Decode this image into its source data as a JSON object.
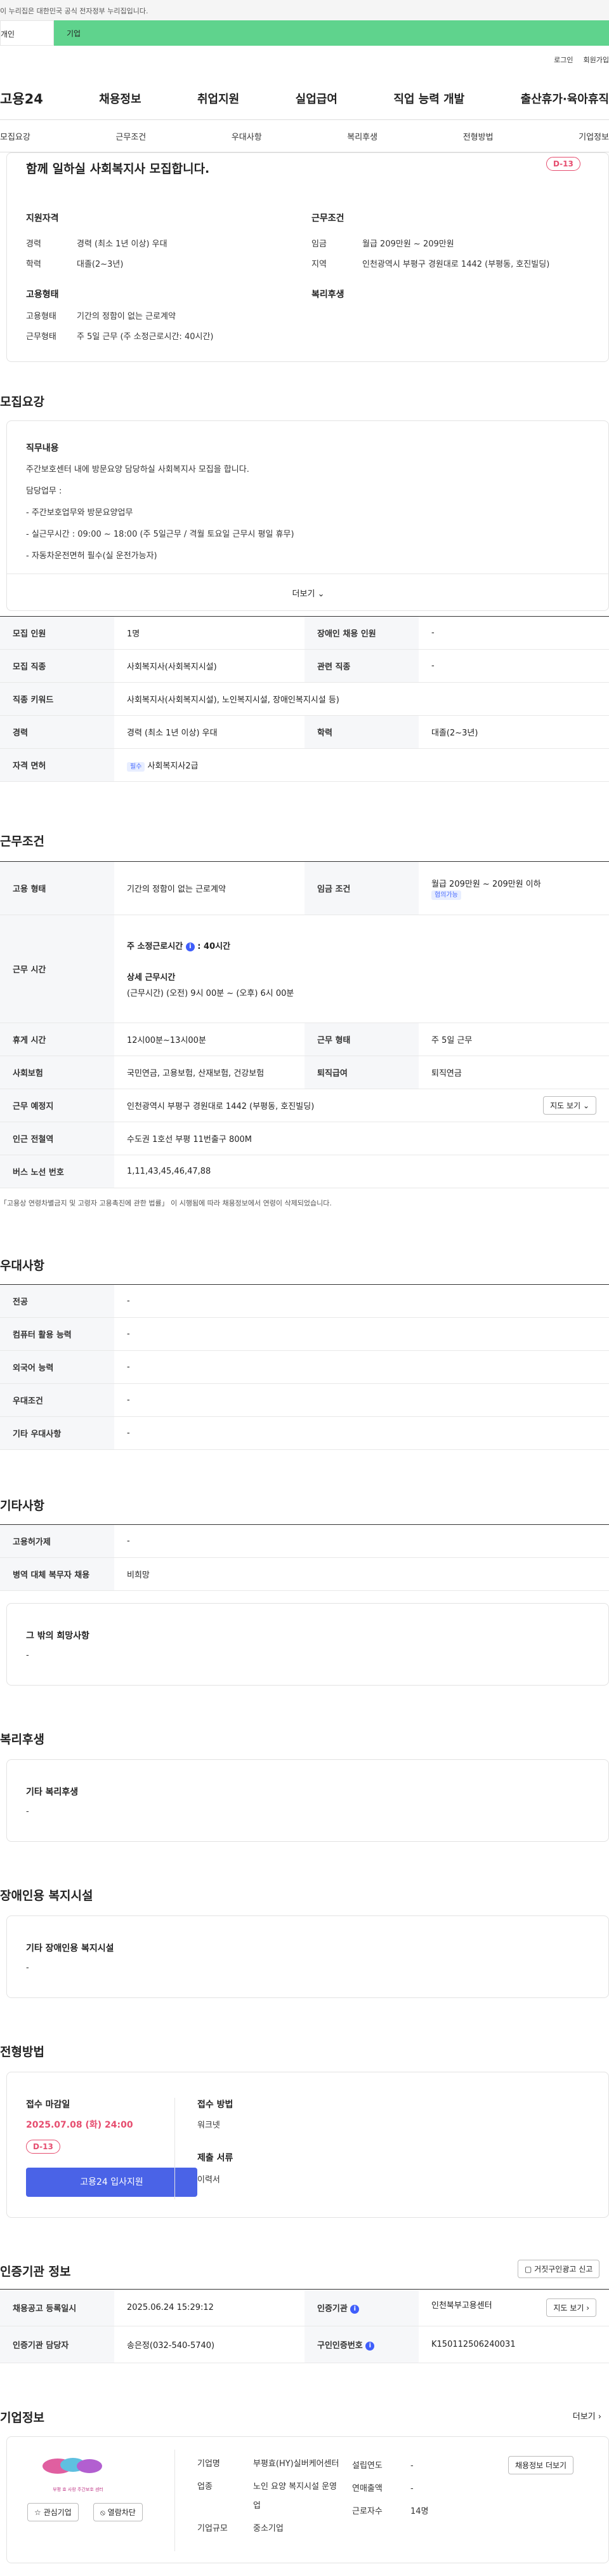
{
  "gov_banner": "이 누리집은 대한민국 공식 전자정부 누리집입니다.",
  "tabs": [
    "개인",
    "기업"
  ],
  "util": [
    "로그인",
    "회원가입"
  ],
  "gnb": {
    "logo": "고용24",
    "items": [
      "채용정보",
      "취업지원",
      "실업급여",
      "직업 능력 개발",
      "출산휴가·육아휴직"
    ]
  },
  "subnav": [
    "모집요강",
    "근무조건",
    "우대사항",
    "복리후생",
    "전형방법",
    "기업정보"
  ],
  "summary": {
    "title": "함께 일하실 사회복지사 모집합니다.",
    "dday": "D-13",
    "qual_title": "지원자격",
    "qual": [
      {
        "k": "경력",
        "v": "경력 (최소 1년 이상) 우대"
      },
      {
        "k": "학력",
        "v": "대졸(2~3년)"
      }
    ],
    "cond_title": "근무조건",
    "cond": [
      {
        "k": "임금",
        "v": "월급 209만원 ~ 209만원"
      },
      {
        "k": "지역",
        "v": "인천광역시 부평구 경원대로 1442 (부평동, 호진빌딩)"
      }
    ],
    "emp_title": "고용형태",
    "emp": [
      {
        "k": "고용형태",
        "v": "기간의 정함이 없는 근로계약"
      },
      {
        "k": "근무형태",
        "v": "주 5일 근무 (주 소정근로시간: 40시간)"
      }
    ],
    "welfare_title": "복리후생"
  },
  "recruit": {
    "heading": "모집요강",
    "box_title": "직무내용",
    "lines": [
      "주간보호센터 내에 방문요양 담당하실 사회복지사 모집을 합니다.",
      "담당업무 :",
      "- 주간보호업무와 방문요양업무",
      "- 실근무시간 : 09:00 ~ 18:00 (주 5일근무 / 격월 토요일 근무시 평일 휴무)",
      "- 자동차운전면허 필수(실 운전가능자)"
    ],
    "more": "더보기",
    "rows": {
      "r1": [
        "모집 인원",
        "1명",
        "장애인 채용 인원",
        "-"
      ],
      "r2": [
        "모집 직종",
        "사회복지사(사회복지시설)",
        "관련 직종",
        "-"
      ],
      "r3": [
        "직종 키워드",
        "사회복지사(사회복지시설), 노인복지시설, 장애인복지시설 등)"
      ],
      "r4": [
        "경력",
        "경력 (최소 1년 이상) 우대",
        "학력",
        "대졸(2~3년)"
      ],
      "r5": [
        "자격 면허",
        "필수",
        "사회복지사2급"
      ]
    }
  },
  "work": {
    "heading": "근무조건",
    "emp_type": [
      "고용 형태",
      "기간의 정함이 없는 근로계약",
      "임금 조건",
      "월급 209만원 ~ 209만원 이하",
      "협의가능"
    ],
    "hours": [
      "근무 시간",
      "주 소정근로시간",
      "40시간",
      "상세 근무시간",
      "(근무시간) (오전) 9시 00분 ~ (오후) 6시 00분"
    ],
    "r3": [
      "휴게 시간",
      "12시00분~13시00분",
      "근무 형태",
      "주 5일 근무"
    ],
    "r4": [
      "사회보험",
      "국민연금, 고용보험, 산재보험, 건강보험",
      "퇴직급여",
      "퇴직연금"
    ],
    "r5": [
      "근무 예정지",
      "인천광역시 부평구 경원대로 1442 (부평동, 호진빌딩)",
      "지도 보기"
    ],
    "r6": [
      "인근 전철역",
      "수도권 1호선 부평 11번출구 800M"
    ],
    "r7": [
      "버스 노선 번호",
      "1,11,43,45,46,47,88"
    ],
    "note": "「고용상 연령차별금지 및 고령자 고용촉진에 관한 법률」 이 시행됨에 따라 채용정보에서 연령이 삭제되었습니다."
  },
  "pref": {
    "heading": "우대사항",
    "rows": [
      [
        "전공",
        "-"
      ],
      [
        "컴퓨터 활용 능력",
        "-"
      ],
      [
        "외국어 능력",
        "-"
      ],
      [
        "우대조건",
        "-"
      ],
      [
        "기타 우대사항",
        "-"
      ]
    ]
  },
  "etc": {
    "heading": "기타사항",
    "rows": [
      [
        "고용허가제",
        "-"
      ],
      [
        "병역 대체 복무자 채용",
        "비희망"
      ]
    ],
    "box_title": "그 밖의 희망사항",
    "box_val": "-"
  },
  "welfare": {
    "heading": "복리후생",
    "box_title": "기타 복리후생",
    "box_val": "-"
  },
  "disabled": {
    "heading": "장애인용 복지시설",
    "box_title": "기타 장애인용 복지시설",
    "box_val": "-"
  },
  "selection": {
    "heading": "전형방법",
    "deadline_label": "접수 마감일",
    "deadline": "2025.07.08 (화) 24:00",
    "dday": "D-13",
    "apply": "고용24 입사지원",
    "method_label": "접수 방법",
    "method": "워크넷",
    "docs_label": "제출 서류",
    "docs": "이력서"
  },
  "agency": {
    "heading": "인증기관 정보",
    "report": "거짓구인광고 신고",
    "r1": [
      "채용공고 등록일시",
      "2025.06.24 15:29:12",
      "인증기관",
      "인천북부고용센터",
      "지도 보기"
    ],
    "r2": [
      "인증기관 담당자",
      "송은정(032-540-5740)",
      "구인인증번호",
      "K150112506240031"
    ]
  },
  "company": {
    "heading": "기업정보",
    "more": "더보기",
    "fav": "관심기업",
    "block": "열람차단",
    "logo_text": "부평 효 사랑 주간보호 센터",
    "list_btn": "채용정보 더보기",
    "info": [
      [
        "기업명",
        "부평효(HY)실버케어센터"
      ],
      [
        "업종",
        "노인 요양 복지시설 운영업"
      ],
      [
        "기업규모",
        "중소기업"
      ]
    ],
    "info2": [
      [
        "설립연도",
        "-"
      ],
      [
        "연매출액",
        "-"
      ],
      [
        "근로자수",
        "14명"
      ]
    ]
  }
}
